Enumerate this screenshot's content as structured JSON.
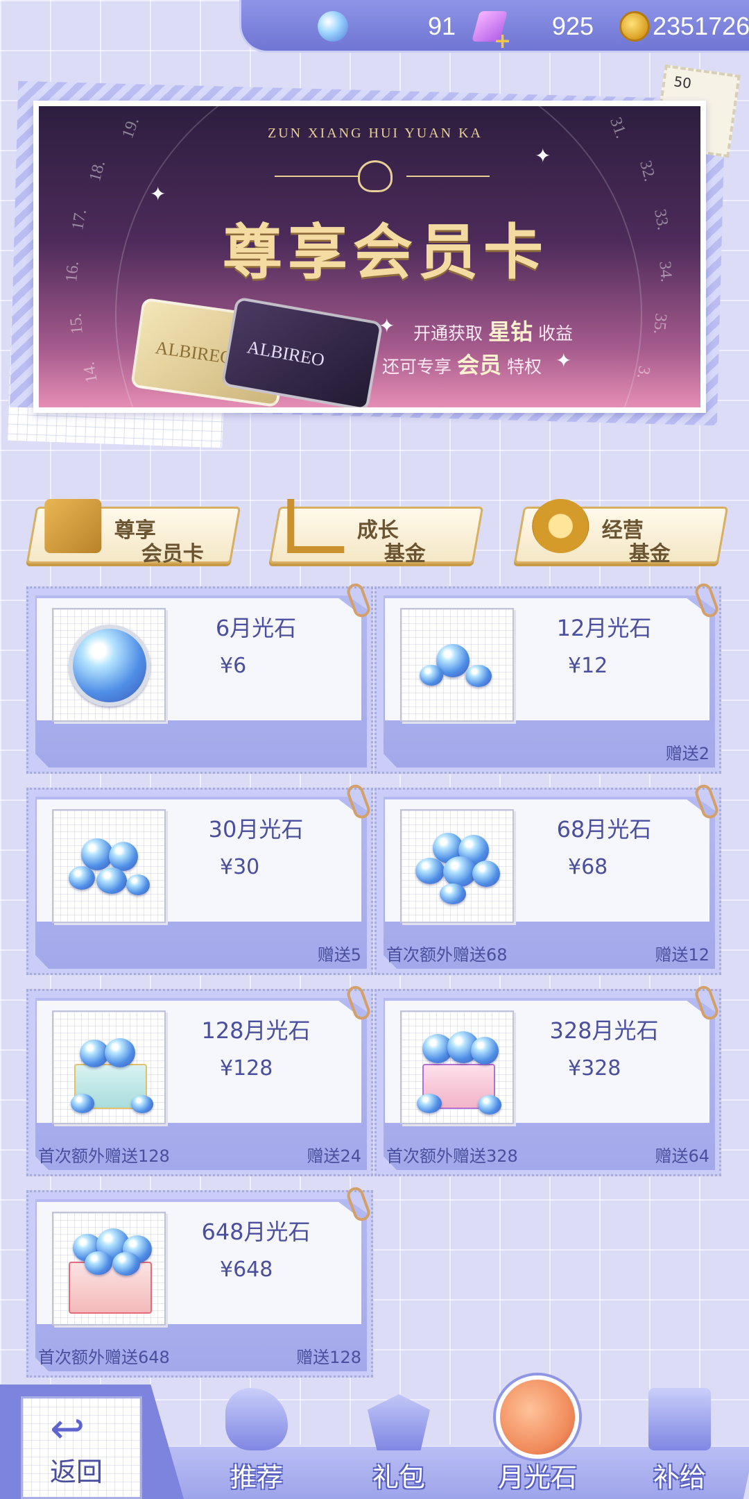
{
  "currency": {
    "gem": {
      "icon": "blue-gem-icon",
      "value": "91"
    },
    "crystal": {
      "icon": "purple-crystal-plus-icon",
      "value": "925"
    },
    "gold": {
      "icon": "gold-coin-icon",
      "value": "2351726"
    }
  },
  "stamp": {
    "number": "50"
  },
  "banner": {
    "subtitle": "ZUN XIANG HUI YUAN KA",
    "title": "尊享会员卡",
    "line1_a": "开通获取",
    "line1_b": "星钻",
    "line1_c": "收益",
    "line2_a": "还可专享",
    "line2_b": "会员",
    "line2_c": "特权",
    "card_brand": "ALBIREO",
    "dial_numbers": [
      "19.",
      "18.",
      "17.",
      "16.",
      "15.",
      "14.",
      "31.",
      "32.",
      "33.",
      "34.",
      "35.",
      "3."
    ]
  },
  "features": [
    {
      "icon": "membership-card-icon",
      "line1": "尊享",
      "line2": "会员卡"
    },
    {
      "icon": "growth-chart-icon",
      "line1": "成长",
      "line2": "基金"
    },
    {
      "icon": "coin-stack-icon",
      "line1": "经营",
      "line2": "基金"
    }
  ],
  "products": [
    {
      "name": "6月光石",
      "price": "¥6",
      "first_bonus": "",
      "gift": ""
    },
    {
      "name": "12月光石",
      "price": "¥12",
      "first_bonus": "",
      "gift": "赠送2"
    },
    {
      "name": "30月光石",
      "price": "¥30",
      "first_bonus": "",
      "gift": "赠送5"
    },
    {
      "name": "68月光石",
      "price": "¥68",
      "first_bonus": "首次额外赠送68",
      "gift": "赠送12"
    },
    {
      "name": "128月光石",
      "price": "¥128",
      "first_bonus": "首次额外赠送128",
      "gift": "赠送24"
    },
    {
      "name": "328月光石",
      "price": "¥328",
      "first_bonus": "首次额外赠送328",
      "gift": "赠送64"
    },
    {
      "name": "648月光石",
      "price": "¥648",
      "first_bonus": "首次额外赠送648",
      "gift": "赠送128"
    }
  ],
  "nav": {
    "back": "返回",
    "tabs": [
      {
        "icon": "swan-icon",
        "label": "推荐"
      },
      {
        "icon": "gift-hearts-icon",
        "label": "礼包"
      },
      {
        "icon": "moonstone-icon",
        "label": "月光石",
        "active": true
      },
      {
        "icon": "shopping-bag-icon",
        "label": "补给"
      }
    ]
  }
}
